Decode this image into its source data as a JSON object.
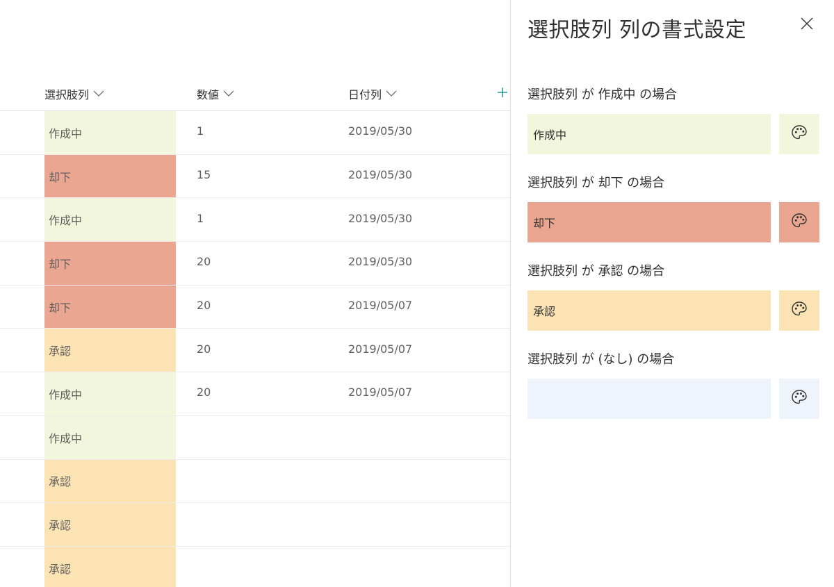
{
  "colors": {
    "in_progress": "#f1f6dc",
    "rejected": "#eaa691",
    "approved": "#fbe3b3",
    "none": "#eff3fb",
    "accent": "#038387"
  },
  "list": {
    "columns": [
      {
        "label": "選択肢列"
      },
      {
        "label": "数値"
      },
      {
        "label": "日付列"
      }
    ],
    "rows": [
      {
        "choice": "作成中",
        "status": "in_progress",
        "number": "1",
        "date": "2019/05/30"
      },
      {
        "choice": "却下",
        "status": "rejected",
        "number": "15",
        "date": "2019/05/30"
      },
      {
        "choice": "作成中",
        "status": "in_progress",
        "number": "1",
        "date": "2019/05/30"
      },
      {
        "choice": "却下",
        "status": "rejected",
        "number": "20",
        "date": "2019/05/30"
      },
      {
        "choice": "却下",
        "status": "rejected",
        "number": "20",
        "date": "2019/05/07"
      },
      {
        "choice": "承認",
        "status": "approved",
        "number": "20",
        "date": "2019/05/07"
      },
      {
        "choice": "作成中",
        "status": "in_progress",
        "number": "20",
        "date": "2019/05/07"
      },
      {
        "choice": "作成中",
        "status": "in_progress",
        "number": "",
        "date": ""
      },
      {
        "choice": "承認",
        "status": "approved",
        "number": "",
        "date": ""
      },
      {
        "choice": "承認",
        "status": "approved",
        "number": "",
        "date": ""
      },
      {
        "choice": "承認",
        "status": "approved",
        "number": "",
        "date": ""
      }
    ]
  },
  "panel": {
    "title": "選択肢列 列の書式設定",
    "close_icon": "close-icon",
    "rules": [
      {
        "label": "選択肢列 が 作成中 の場合",
        "value": "作成中",
        "status": "in_progress"
      },
      {
        "label": "選択肢列 が 却下 の場合",
        "value": "却下",
        "status": "rejected"
      },
      {
        "label": "選択肢列 が 承認 の場合",
        "value": "承認",
        "status": "approved"
      },
      {
        "label": "選択肢列 が (なし) の場合",
        "value": "",
        "status": "none"
      }
    ],
    "palette_icon": "palette-icon"
  }
}
